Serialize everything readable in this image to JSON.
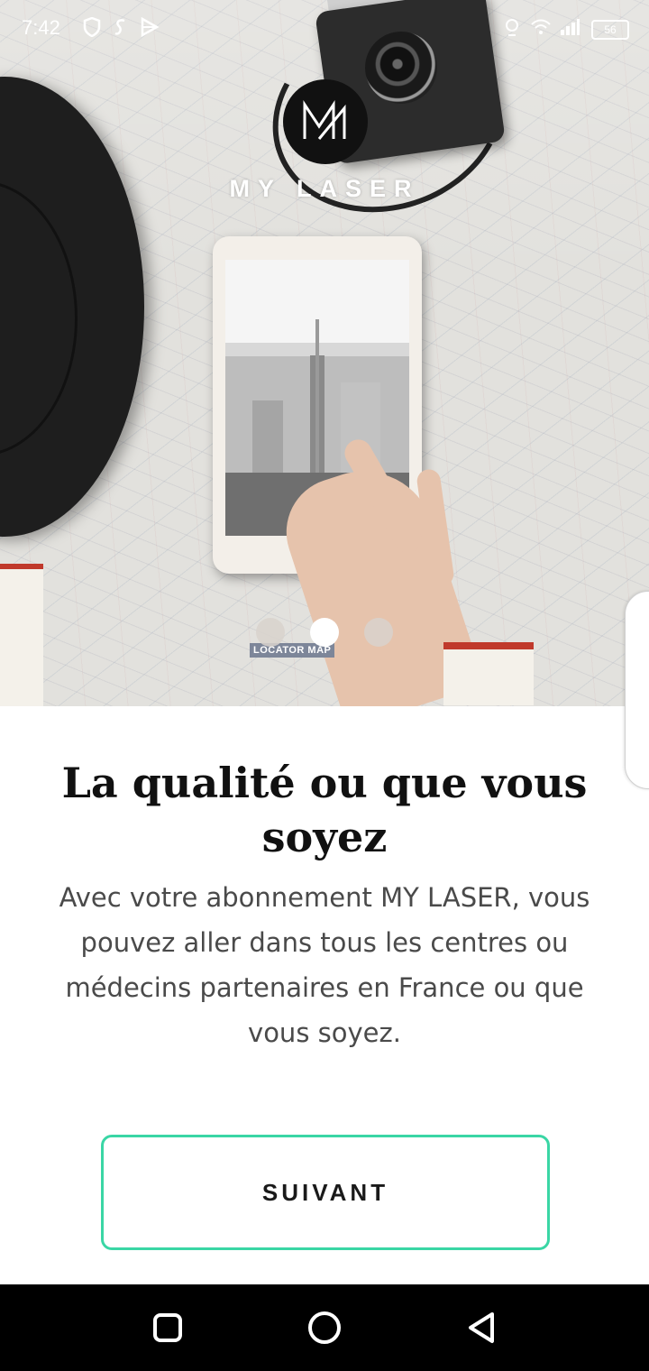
{
  "status_bar": {
    "time": "7:42",
    "battery": "56"
  },
  "brand": {
    "logo_text": "M",
    "name": "MY LASER"
  },
  "hero": {
    "map_label": "LOCATOR MAP"
  },
  "pager": {
    "pages": 3,
    "active_index": 1,
    "active_color": "#ffffff",
    "inactive_color": "#d8d2cc"
  },
  "content": {
    "title": "La qualité ou que vous soyez",
    "description": "Avec votre abonnement MY LASER, vous pouvez aller dans tous les centres ou médecins partenaires en France ou que vous soyez."
  },
  "actions": {
    "next_label": "SUIVANT",
    "accent_color": "#3ad6a5"
  },
  "navigation": {
    "recent_icon": "square-icon",
    "home_icon": "circle-icon",
    "back_icon": "triangle-icon"
  }
}
